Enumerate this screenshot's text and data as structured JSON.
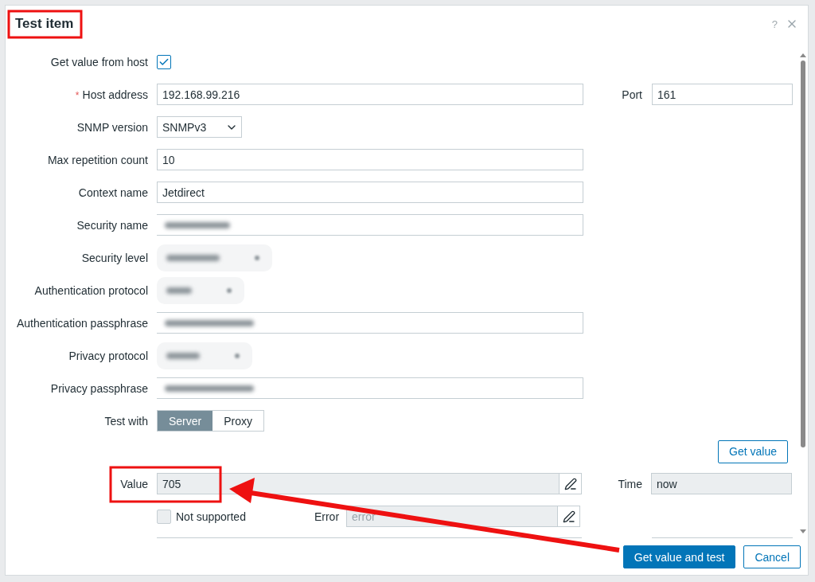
{
  "dialog": {
    "title": "Test item",
    "help": "?"
  },
  "fields": [
    {
      "kind": "checkbox",
      "label": "Get value from host",
      "checked": true
    },
    {
      "kind": "text",
      "label": "Host address",
      "required_mark": "*",
      "value": "192.168.99.216",
      "side_label": "Port",
      "side_value": "161"
    },
    {
      "kind": "select",
      "label": "SNMP version",
      "value": "SNMPv3"
    },
    {
      "kind": "text",
      "label": "Max repetition count",
      "value": "10"
    },
    {
      "kind": "text",
      "label": "Context name",
      "value": "Jetdirect"
    },
    {
      "kind": "blurred-text",
      "label": "Security name"
    },
    {
      "kind": "blurred-select",
      "label": "Security level"
    },
    {
      "kind": "blurred-select",
      "label": "Authentication protocol"
    },
    {
      "kind": "blurred-text",
      "label": "Authentication passphrase"
    },
    {
      "kind": "blurred-select",
      "label": "Privacy protocol"
    },
    {
      "kind": "blurred-text",
      "label": "Privacy passphrase"
    },
    {
      "kind": "segmented",
      "label": "Test with",
      "options": [
        {
          "label": "Server",
          "selected": true
        },
        {
          "label": "Proxy",
          "selected": false
        }
      ]
    }
  ],
  "get_value_button": "Get value",
  "result": {
    "value_label": "Value",
    "value": "705",
    "time_label": "Time",
    "time": "now",
    "not_supported": {
      "label": "Not supported",
      "checked": false
    },
    "error_label": "Error",
    "error_placeholder": "error"
  },
  "footer_buttons": [
    {
      "label": "Get value and test",
      "kind": "primary"
    },
    {
      "label": "Cancel",
      "kind": "secondary"
    }
  ]
}
